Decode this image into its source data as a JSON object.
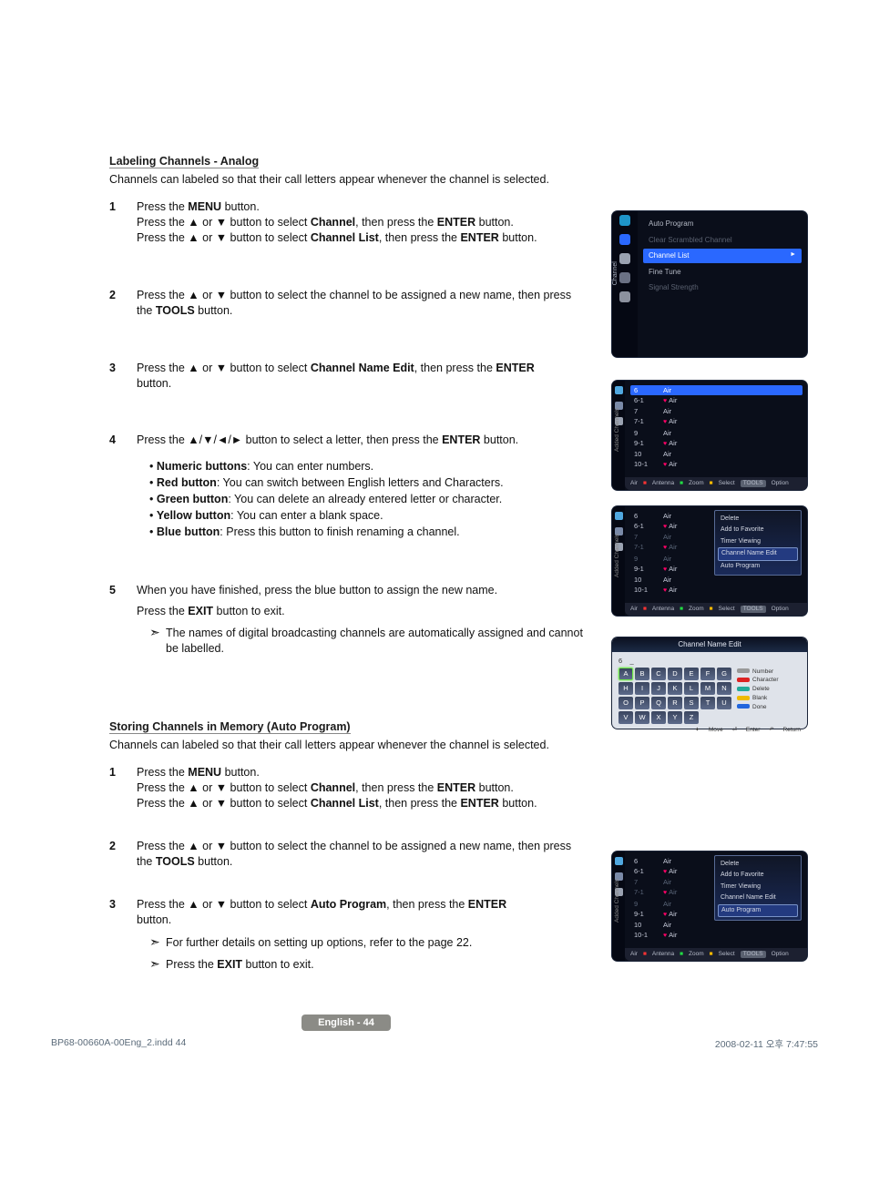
{
  "section1": {
    "title": "Labeling Channels - Analog",
    "intro": "Channels can labeled so that their call letters appear whenever the channel is selected.",
    "step1": {
      "num": "1",
      "l1a": "Press the ",
      "l1b": "MENU",
      "l1c": " button.",
      "l2a": "Press the ▲ or ▼ button to select ",
      "l2b": "Channel",
      "l2c": ", then press the ",
      "l2d": "ENTER",
      "l2e": " button.",
      "l3a": "Press the ▲ or ▼ button to select ",
      "l3b": "Channel List",
      "l3c": ", then press the ",
      "l3d": "ENTER",
      "l3e": " button."
    },
    "step2": {
      "num": "2",
      "l1a": "Press the ▲ or ▼ button to select the channel to be assigned a new name, then press the ",
      "l1b": "TOOLS",
      "l1c": " button."
    },
    "step3": {
      "num": "3",
      "l1a": "Press the ▲ or ▼ button to select ",
      "l1b": "Channel Name Edit",
      "l1c": ", then press the ",
      "l1d": "ENTER",
      "l2": "button."
    },
    "step4": {
      "num": "4",
      "l1a": "Press the ▲/▼/◄/► button to select a letter, then press the ",
      "l1b": "ENTER",
      "l1c": " button.",
      "b1a": "Numeric buttons",
      "b1b": ": You can enter numbers.",
      "b2a": "Red button",
      "b2b": ": You can switch between English letters and Characters.",
      "b3a": "Green button",
      "b3b": ": You can delete an already entered letter or character.",
      "b4a": "Yellow button",
      "b4b": ": You can enter a blank space.",
      "b5a": "Blue button",
      "b5b": ": Press this button to finish renaming a channel."
    },
    "step5": {
      "num": "5",
      "l1": "When you have finished, press the blue button to assign the new name.",
      "l2a": "Press the ",
      "l2b": "EXIT",
      "l2c": " button to exit.",
      "note": "The names of digital broadcasting channels are automatically assigned and cannot be labelled."
    }
  },
  "section2": {
    "title": "Storing Channels in Memory (Auto Program)",
    "intro": "Channels can labeled so that their call letters appear whenever the channel is selected.",
    "step1": {
      "num": "1",
      "l1a": "Press the ",
      "l1b": "MENU",
      "l1c": " button.",
      "l2a": "Press the ▲ or ▼ button to select ",
      "l2b": "Channel",
      "l2c": ", then press the ",
      "l2d": "ENTER",
      "l2e": " button.",
      "l3a": "Press the ▲ or ▼ button to select ",
      "l3b": "Channel List",
      "l3c": ", then press the ",
      "l3d": "ENTER",
      "l3e": " button."
    },
    "step2": {
      "num": "2",
      "l1a": "Press the ▲ or ▼ button to select the channel to be assigned a new name, then press the ",
      "l1b": "TOOLS",
      "l1c": " button."
    },
    "step3": {
      "num": "3",
      "l1a": "Press the ▲ or ▼ button to select ",
      "l1b": "Auto Program",
      "l1c": ", then press the ",
      "l1d": "ENTER",
      "l2": "button.",
      "note1": "For further details on setting up options, refer to the page 22.",
      "note2a": "Press the ",
      "note2b": "EXIT",
      "note2c": " button to exit."
    }
  },
  "pagebadge": "English - 44",
  "footer": {
    "left": "BP68-00660A-00Eng_2.indd   44",
    "right": "2008-02-11   오후 7:47:55"
  },
  "osd1": {
    "sidetxt": "Channel",
    "m1": "Auto Program",
    "m2": "Clear Scrambled Channel",
    "m3": "Channel List",
    "m4": "Fine Tune",
    "m5": "Signal Strength"
  },
  "channels": {
    "r0n": "6",
    "r0a": "Air",
    "r1n": "6-1",
    "r1a": "Air",
    "r2n": "7",
    "r2a": "Air",
    "r3n": "7-1",
    "r3a": "Air",
    "r4n": "9",
    "r4a": "Air",
    "r5n": "9-1",
    "r5a": "Air",
    "r6n": "10",
    "r6a": "Air",
    "r7n": "10-1",
    "r7a": "Air"
  },
  "bbar": {
    "air": "Air",
    "ant": "Antenna",
    "zoom": "Zoom",
    "sel": "Select",
    "tools": "TOOLS",
    "opt": "Option"
  },
  "sb2txt": "Added Channels",
  "popup": {
    "del": "Delete",
    "fav": "Add to Favorite",
    "tim": "Timer Viewing",
    "cne": "Channel Name Edit",
    "ap": "Auto Program"
  },
  "kb": {
    "title": "Channel Name Edit",
    "top_num": "6",
    "top_dash": "_",
    "keys": [
      "A",
      "B",
      "C",
      "D",
      "E",
      "F",
      "G",
      "H",
      "I",
      "J",
      "K",
      "L",
      "M",
      "N",
      "O",
      "P",
      "Q",
      "R",
      "S",
      "T",
      "U",
      "V",
      "W",
      "X",
      "Y",
      "Z"
    ],
    "leg_num": "Number",
    "leg_char": "Character",
    "leg_del": "Delete",
    "leg_blank": "Blank",
    "leg_done": "Done",
    "move": "Move",
    "enter": "Enter",
    "ret": "Return"
  }
}
